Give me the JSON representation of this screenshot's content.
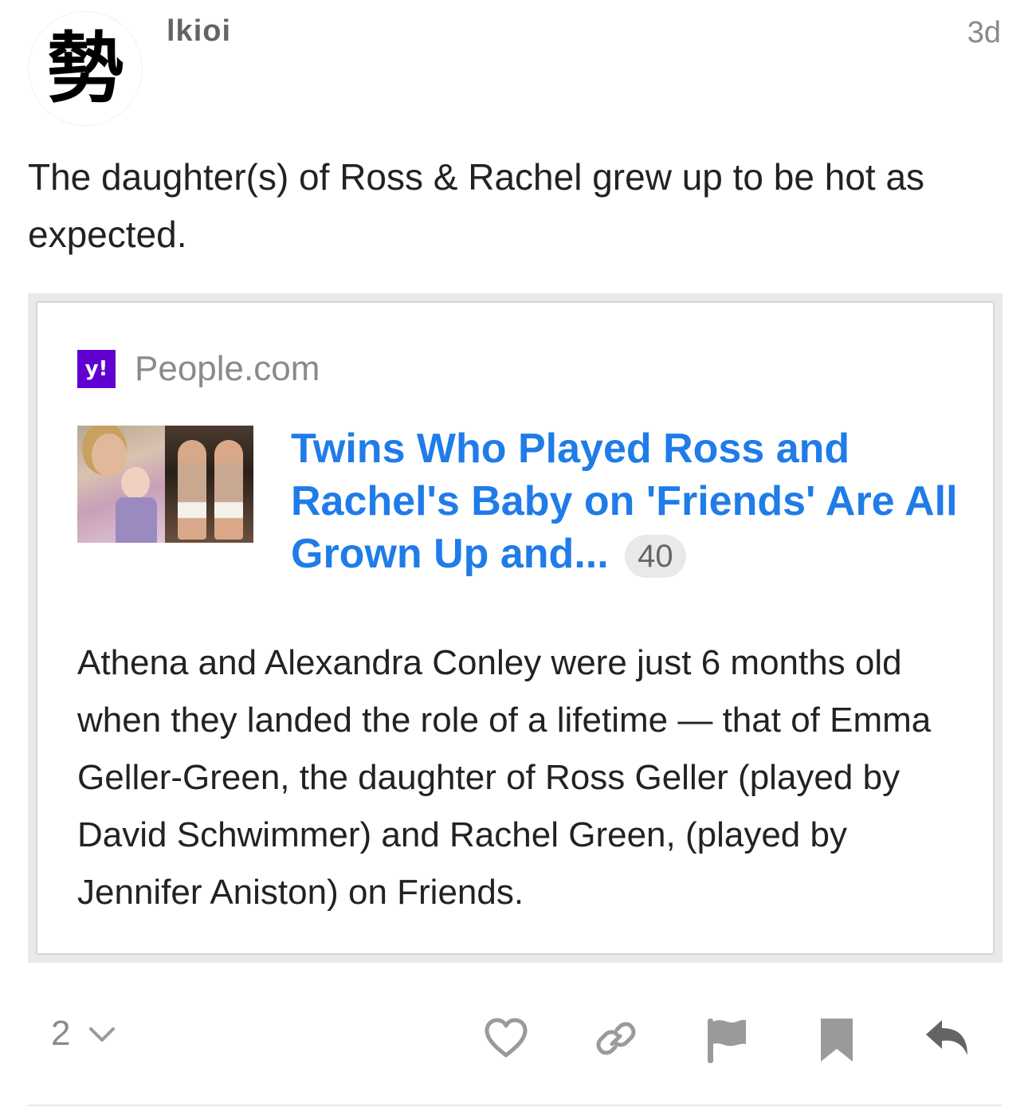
{
  "post": {
    "avatar_glyph": "勢",
    "username": "lkioi",
    "date": "3d",
    "text": "The daughter(s) of Ross & Rachel grew up to be hot as expected."
  },
  "onebox": {
    "favicon_text": "y!",
    "favicon_color": "#6001d2",
    "source": "People.com",
    "title": "Twins Who Played Ross and Rachel's Baby on 'Friends' Are All Grown Up and...",
    "click_count": "40",
    "description": "Athena and Alexandra Conley were just 6 months old when they landed the role of a lifetime — that of Emma Geller-Green, the daughter of Ross Geller (played by David Schwimmer) and Rachel Green, (played by Jennifer Aniston) on Friends.",
    "link_color": "#1f7ce8"
  },
  "footer": {
    "like_count": "2",
    "icons": [
      "chevron-down-icon",
      "heart-icon",
      "link-icon",
      "flag-icon",
      "bookmark-icon",
      "reply-icon"
    ]
  }
}
